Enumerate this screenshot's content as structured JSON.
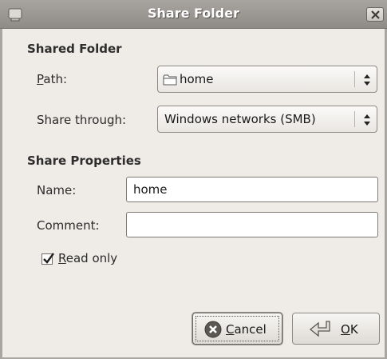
{
  "window": {
    "title": "Share Folder",
    "close_icon": "close-icon"
  },
  "shared_folder": {
    "heading": "Shared Folder",
    "path_label_mnemonic": "P",
    "path_label_rest": "ath:",
    "path_value": "home",
    "path_icon": "folder-icon",
    "share_through_label": "Share through:",
    "share_through_value": "Windows networks (SMB)"
  },
  "share_properties": {
    "heading": "Share Properties",
    "name_label": "Name:",
    "name_value": "home",
    "comment_label": "Comment:",
    "comment_value": "",
    "read_only_mnemonic": "R",
    "read_only_rest": "ead only",
    "read_only_checked": true
  },
  "buttons": {
    "cancel_mnemonic": "C",
    "cancel_rest": "ancel",
    "ok_mnemonic": "O",
    "ok_rest": "K"
  }
}
